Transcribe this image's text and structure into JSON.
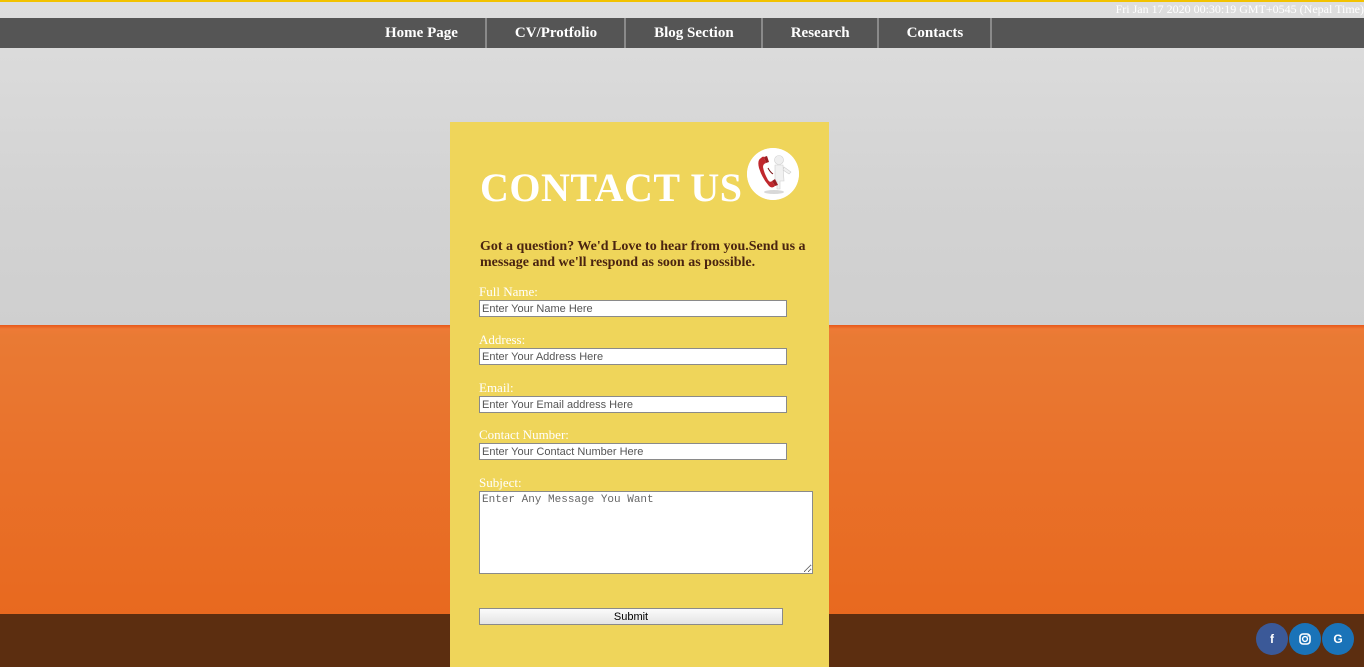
{
  "clock": "Fri Jan 17 2020 00:30:19 GMT+0545 (Nepal Time)",
  "nav": {
    "items": [
      {
        "label": "Home Page"
      },
      {
        "label": "CV/Protfolio"
      },
      {
        "label": "Blog Section"
      },
      {
        "label": "Research"
      },
      {
        "label": "Contacts"
      }
    ]
  },
  "contact": {
    "title": "CONTACT US",
    "title_icon": "phone-icon",
    "intro": "Got a question? We'd Love to hear from you.Send us a message and we'll respond as soon as possible.",
    "fields": {
      "name": {
        "label": "Full Name:",
        "placeholder": "Enter Your Name Here"
      },
      "address": {
        "label": "Address:",
        "placeholder": "Enter Your Address Here"
      },
      "email": {
        "label": "Email:",
        "placeholder": "Enter Your Email address Here"
      },
      "phone": {
        "label": "Contact Number:",
        "placeholder": "Enter Your Contact Number Here"
      },
      "subject": {
        "label": "Subject:",
        "placeholder": "Enter Any Message You Want"
      }
    },
    "submit_label": "Submit"
  },
  "social": {
    "facebook": {
      "icon": "facebook-icon",
      "glyph": "f",
      "color": "#3b5998"
    },
    "instagram": {
      "icon": "instagram-icon",
      "color": "#1a73b8"
    },
    "google": {
      "icon": "google-icon",
      "glyph": "G",
      "color": "#1a73b8"
    }
  },
  "colors": {
    "card": "#efd55a",
    "navbar": "#555555",
    "floor": "#5c2e10"
  }
}
